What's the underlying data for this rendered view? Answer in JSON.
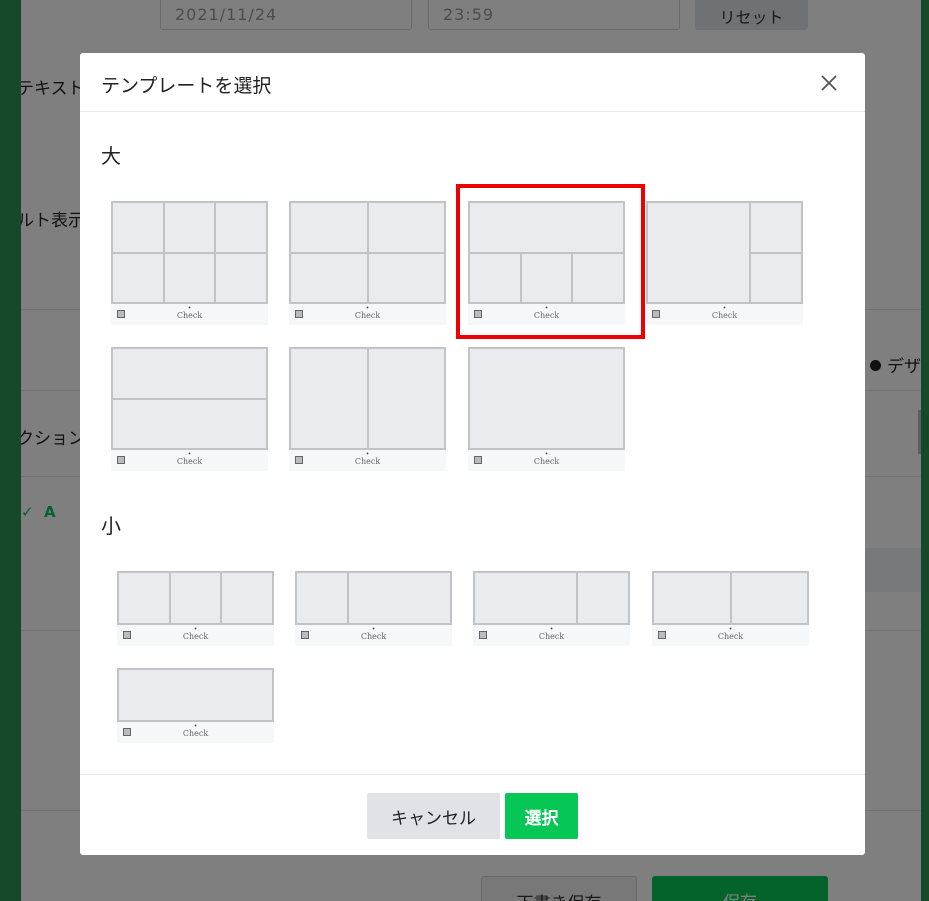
{
  "background": {
    "date_value": "2021/11/24",
    "time_value": "23:59",
    "reset_label": "リセット",
    "label_text": "テキスト",
    "label_default_display": "ルト表示",
    "label_action": "クション",
    "radio_design": "デザ",
    "accordion_a": "A",
    "draft_save_label": "下書き保存",
    "save_label": "保存"
  },
  "modal": {
    "title": "テンプレートを選択",
    "large_section": {
      "title": "大",
      "templates": [
        {
          "layout": "6-grid-3x2",
          "check_label": "Check",
          "selected": false
        },
        {
          "layout": "4-grid-2x2",
          "check_label": "Check",
          "selected": false
        },
        {
          "layout": "1-top-3-bottom",
          "check_label": "Check",
          "selected": true
        },
        {
          "layout": "1-left-2-right",
          "check_label": "Check",
          "selected": false
        },
        {
          "layout": "2-rows",
          "check_label": "Check",
          "selected": false
        },
        {
          "layout": "2-columns",
          "check_label": "Check",
          "selected": false
        },
        {
          "layout": "1-full",
          "check_label": "Check",
          "selected": false
        }
      ]
    },
    "small_section": {
      "title": "小",
      "templates": [
        {
          "layout": "3-columns",
          "check_label": "Check",
          "selected": false
        },
        {
          "layout": "narrow-left-wide-right",
          "check_label": "Check",
          "selected": false
        },
        {
          "layout": "wide-left-narrow-right",
          "check_label": "Check",
          "selected": false
        },
        {
          "layout": "2-equal-columns",
          "check_label": "Check",
          "selected": false
        },
        {
          "layout": "1-full",
          "check_label": "Check",
          "selected": false
        }
      ]
    },
    "footer": {
      "cancel_label": "キャンセル",
      "select_label": "選択"
    }
  },
  "colors": {
    "accent_green": "#06c755",
    "selection_red": "#ee0000",
    "frame_green": "#2a9352"
  }
}
